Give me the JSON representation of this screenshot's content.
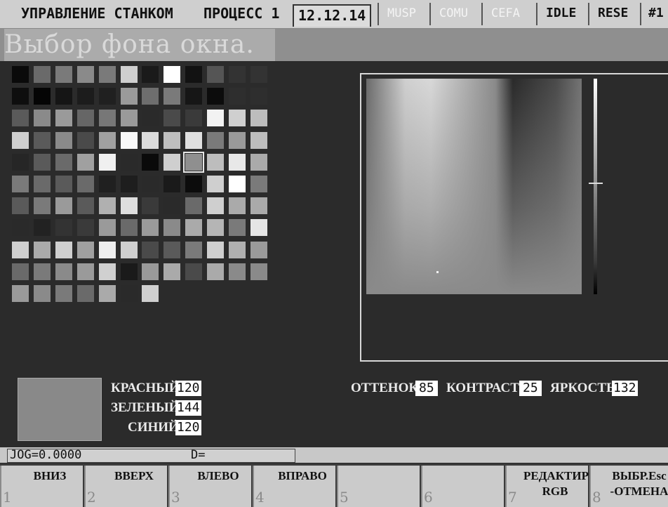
{
  "topbar": {
    "mode_title": "УПРАВЛЕНИЕ СТАНКОМ",
    "process": "ПРОЦЕСС 1",
    "date": "12.12.14",
    "musp": "MUSP",
    "comu": "COMU",
    "cefa": "CEFA",
    "idle": "IDLE",
    "rese": "RESE",
    "channel": "#1"
  },
  "title": "Выбор фона окна.",
  "palette": {
    "swatches": [
      [
        "#0a0a0a",
        "#6a6a6a",
        "#7a7a7a",
        "#8a8a8a",
        "#7a7a7a",
        "#cfcfcf",
        "#1a1a1a",
        "#ffffff",
        "#121212",
        "#555555",
        "#333333",
        "#333333"
      ],
      [
        "#0e0e0e",
        "#050505",
        "#151515",
        "#1c1c1c",
        "#202020",
        "#9a9a9a",
        "#6e6e6e",
        "#7a7a7a",
        "#161616",
        "#0c0c0c",
        "#2e2e2e",
        "#2e2e2e"
      ],
      [
        "#5a5a5a",
        "#8a8a8a",
        "#9a9a9a",
        "#666666",
        "#777777",
        "#9a9a9a",
        "#2a2a2a",
        "#4a4a4a",
        "#3a3a3a",
        "#f2f2f2",
        "#cfcfcf",
        "#bdbdbd"
      ],
      [
        "#cfcfcf",
        "#5a5a5a",
        "#8a8a8a",
        "#4a4a4a",
        "#a0a0a0",
        "#f8f8f8",
        "#dcdcdc",
        "#bebebe",
        "#e0e0e0",
        "#7a7a7a",
        "#9a9a9a",
        "#bdbdbd"
      ],
      [
        "#262626",
        "#5a5a5a",
        "#6a6a6a",
        "#a0a0a0",
        "#f0f0f0",
        "#2a2a2a",
        "#0a0a0a",
        "#cfcfcf",
        "#8f8f8f",
        "#bdbdbd",
        "#e8e8e8",
        "#aaaaaa"
      ],
      [
        "#7a7a7a",
        "#6a6a6a",
        "#5a5a5a",
        "#6a6a6a",
        "#202020",
        "#1e1e1e",
        "#2a2a2a",
        "#1a1a1a",
        "#0c0c0c",
        "#cfcfcf",
        "#ffffff",
        "#7a7a7a"
      ],
      [
        "#5a5a5a",
        "#7a7a7a",
        "#9a9a9a",
        "#5a5a5a",
        "#b0b0b0",
        "#dedede",
        "#3a3a3a",
        "#2a2a2a",
        "#6a6a6a",
        "#cfcfcf",
        "#aaaaaa",
        "#aaaaaa"
      ],
      [
        "#2a2a2a",
        "#222222",
        "#333333",
        "#3a3a3a",
        "#9a9a9a",
        "#6a6a6a",
        "#9a9a9a",
        "#8a8a8a",
        "#aaaaaa",
        "#b5b5b5",
        "#7a7a7a",
        "#e5e5e5"
      ],
      [
        "#cfcfcf",
        "#aaaaaa",
        "#cfcfcf",
        "#a0a0a0",
        "#eeeeee",
        "#cfcfcf",
        "#4a4a4a",
        "#5a5a5a",
        "#7a7a7a",
        "#cfcfcf",
        "#b0b0b0",
        "#9a9a9a"
      ],
      [
        "#6a6a6a",
        "#7a7a7a",
        "#8a8a8a",
        "#9a9a9a",
        "#d0d0d0",
        "#1a1a1a",
        "#9a9a9a",
        "#aaaaaa",
        "#4a4a4a",
        "#aaaaaa",
        "#8a8a8a",
        "#8a8a8a"
      ],
      [
        "#9a9a9a",
        "#8a8a8a",
        "#7a7a7a",
        "#6a6a6a",
        "#aaaaaa",
        "#2a2a2a",
        "#cfcfcf"
      ]
    ],
    "selected": "4-8"
  },
  "rgb": {
    "red_label": "КРАСНЫЙ",
    "red": "120",
    "green_label": "ЗЕЛЕНЫЙ",
    "green": "144",
    "blue_label": "СИНИЙ",
    "blue": "120"
  },
  "hsl": {
    "hue_label": "ОТТЕНОК",
    "hue": "85",
    "contrast_label": "КОНТРАСТ",
    "contrast": "25",
    "brightness_label": "ЯРКОСТЬ",
    "brightness": "132"
  },
  "status": {
    "jog": "JOG=0.0000",
    "d": "D="
  },
  "softkeys": [
    {
      "num": "1",
      "label": "ВНИЗ"
    },
    {
      "num": "2",
      "label": "ВВЕРХ"
    },
    {
      "num": "3",
      "label": "ВЛЕВО"
    },
    {
      "num": "4",
      "label": "ВПРАВО"
    },
    {
      "num": "5",
      "label": ""
    },
    {
      "num": "6",
      "label": ""
    },
    {
      "num": "7",
      "label": "РЕДАКТИР\nRGB"
    },
    {
      "num": "8",
      "label": "ВЫБР.Esc\n-ОТМЕНА"
    }
  ]
}
